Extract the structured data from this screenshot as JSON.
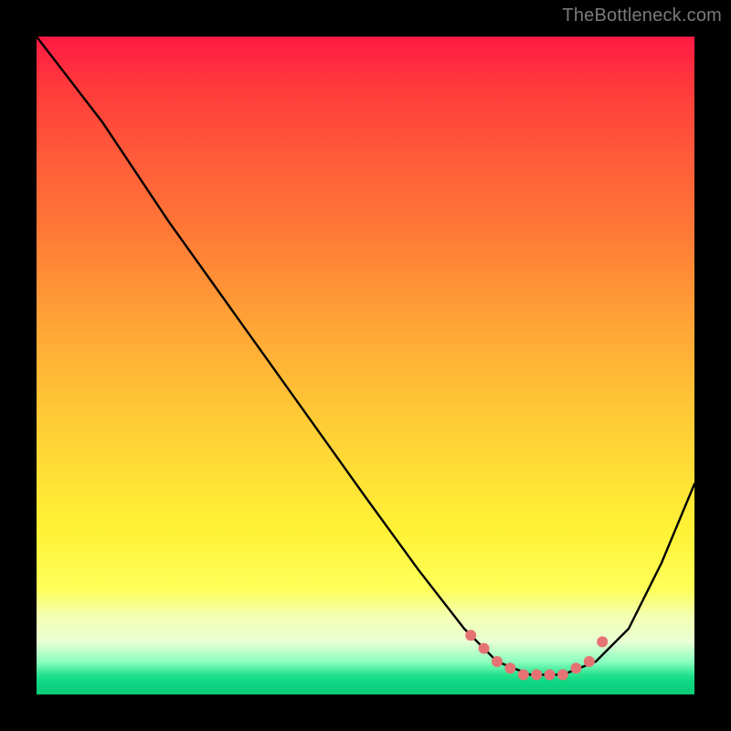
{
  "watermark": "TheBottleneck.com",
  "chart_data": {
    "type": "line",
    "title": "",
    "xlabel": "",
    "ylabel": "",
    "xlim": [
      0,
      100
    ],
    "ylim": [
      0,
      100
    ],
    "grid": false,
    "series": [
      {
        "name": "curve",
        "color": "#000000",
        "x": [
          0,
          10,
          20,
          30,
          40,
          50,
          58,
          65,
          70,
          75,
          80,
          85,
          90,
          95,
          100
        ],
        "y": [
          100,
          87,
          72,
          58,
          44,
          30,
          19,
          10,
          5,
          3,
          3,
          5,
          10,
          20,
          32
        ]
      }
    ],
    "markers": {
      "name": "optimal-band",
      "color": "#e57373",
      "x": [
        66,
        68,
        70,
        72,
        74,
        76,
        78,
        80,
        82,
        84,
        86
      ],
      "y": [
        9,
        7,
        5,
        4,
        3,
        3,
        3,
        3,
        4,
        5,
        8
      ]
    }
  }
}
